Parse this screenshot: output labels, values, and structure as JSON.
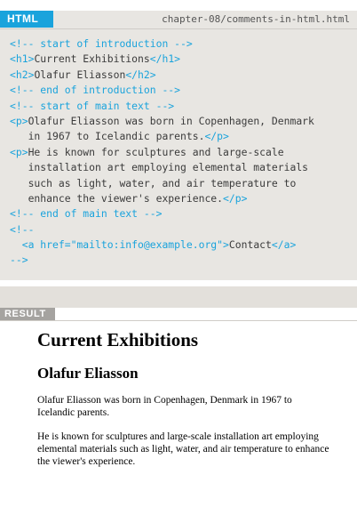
{
  "code_panel": {
    "tab_label": "HTML",
    "file_path": "chapter-08/comments-in-html.html",
    "lines": [
      [
        {
          "cls": "c",
          "text": "<!-- start of introduction -->"
        }
      ],
      [
        {
          "cls": "c",
          "text": "<h1>"
        },
        {
          "cls": "t",
          "text": "Current Exhibitions"
        },
        {
          "cls": "c",
          "text": "</h1>"
        }
      ],
      [
        {
          "cls": "c",
          "text": "<h2>"
        },
        {
          "cls": "t",
          "text": "Olafur Eliasson"
        },
        {
          "cls": "c",
          "text": "</h2>"
        }
      ],
      [
        {
          "cls": "c",
          "text": "<!-- end of introduction -->"
        }
      ],
      [
        {
          "cls": "c",
          "text": "<!-- start of main text -->"
        }
      ],
      [
        {
          "cls": "c",
          "text": "<p>"
        },
        {
          "cls": "t",
          "text": "Olafur Eliasson was born in Copenhagen, Denmark"
        }
      ],
      [
        {
          "cls": "t",
          "text": "   in 1967 to Icelandic parents."
        },
        {
          "cls": "c",
          "text": "</p>"
        }
      ],
      [
        {
          "cls": "c",
          "text": "<p>"
        },
        {
          "cls": "t",
          "text": "He is known for sculptures and large-scale"
        }
      ],
      [
        {
          "cls": "t",
          "text": "   installation art employing elemental materials"
        }
      ],
      [
        {
          "cls": "t",
          "text": "   such as light, water, and air temperature to"
        }
      ],
      [
        {
          "cls": "t",
          "text": "   enhance the viewer's experience."
        },
        {
          "cls": "c",
          "text": "</p>"
        }
      ],
      [
        {
          "cls": "c",
          "text": "<!-- end of main text -->"
        }
      ],
      [
        {
          "cls": "c",
          "text": "<!--"
        }
      ],
      [
        {
          "cls": "c",
          "text": "  <a href=\"mailto:info@example.org\">"
        },
        {
          "cls": "t",
          "text": "Contact"
        },
        {
          "cls": "c",
          "text": "</a>"
        }
      ],
      [
        {
          "cls": "c",
          "text": "-->"
        }
      ]
    ]
  },
  "result_panel": {
    "tab_label": "RESULT",
    "heading": "Current Exhibitions",
    "subheading": "Olafur Eliasson",
    "paragraph_1": "Olafur Eliasson was born in Copenhagen, Denmark in 1967 to Icelandic parents.",
    "paragraph_2": "He is known for sculptures and large-scale installation art employing elemental materials such as light, water, and air temperature to enhance the viewer's experience."
  },
  "colors": {
    "accent_blue": "#1aa3dc",
    "panel_gray": "#e8e6e2",
    "result_tab_gray": "#a5a3a0"
  }
}
